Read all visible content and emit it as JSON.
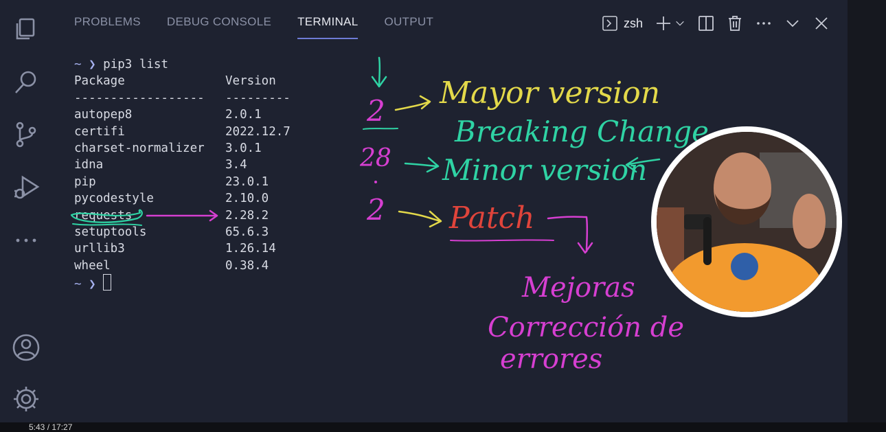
{
  "tabs": [
    {
      "label": "PROBLEMS"
    },
    {
      "label": "DEBUG CONSOLE"
    },
    {
      "label": "TERMINAL"
    },
    {
      "label": "OUTPUT"
    }
  ],
  "toolbar": {
    "shell": "zsh"
  },
  "terminal": {
    "prompt": "~ ❯",
    "command": "pip3 list",
    "header": {
      "package": "Package",
      "version": "Version"
    },
    "separator": {
      "package": "------------------",
      "version": "---------"
    },
    "packages": [
      {
        "name": "autopep8",
        "version": "2.0.1"
      },
      {
        "name": "certifi",
        "version": "2022.12.7"
      },
      {
        "name": "charset-normalizer",
        "version": "3.0.1"
      },
      {
        "name": "idna",
        "version": "3.4"
      },
      {
        "name": "pip",
        "version": "23.0.1"
      },
      {
        "name": "pycodestyle",
        "version": "2.10.0"
      },
      {
        "name": "requests",
        "version": "2.28.2"
      },
      {
        "name": "setuptools",
        "version": "65.6.3"
      },
      {
        "name": "urllib3",
        "version": "1.26.14"
      },
      {
        "name": "wheel",
        "version": "0.38.4"
      }
    ]
  },
  "annotations": {
    "major_digit": "2",
    "minor_digit": "28",
    "patch_digit": "2",
    "major_label": "Mayor version",
    "breaking": "Breaking Change",
    "minor_label": "Minor version",
    "patch_label": "Patch",
    "mejoras": "Mejoras",
    "correccion": "Corrección de",
    "errores": "errores",
    "colors": {
      "yellow": "#e3d94a",
      "teal": "#2fd3a4",
      "magenta": "#d63fd1",
      "red": "#e0443b"
    }
  },
  "player": {
    "time": "5:43 / 17:27"
  }
}
